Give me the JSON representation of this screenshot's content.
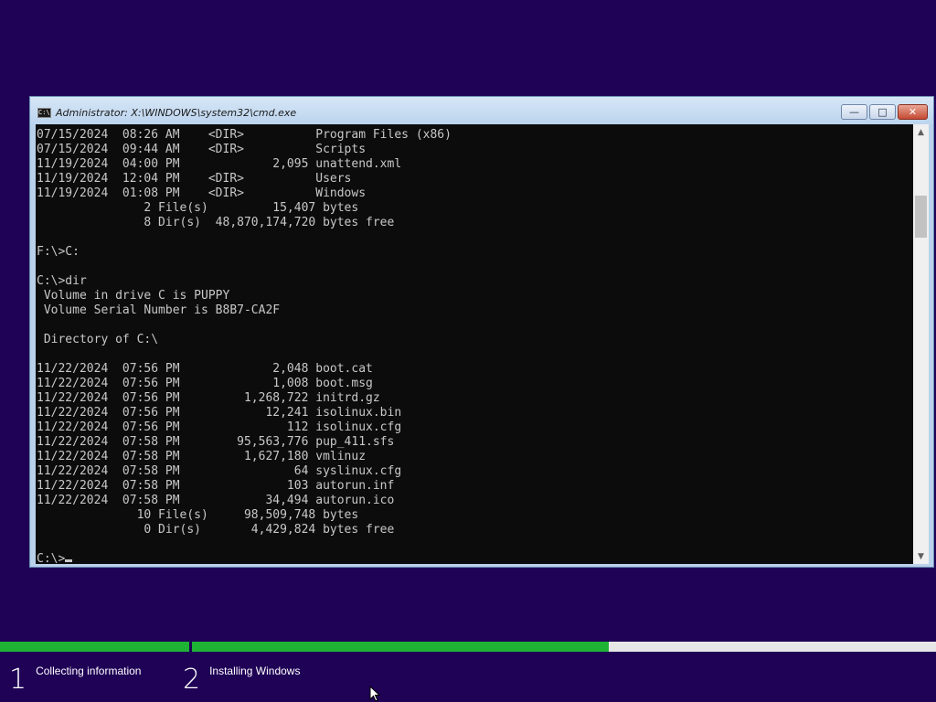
{
  "window": {
    "title": "Administrator: X:\\WINDOWS\\system32\\cmd.exe",
    "minimize_glyph": "—",
    "maximize_glyph": "□",
    "close_glyph": "✕"
  },
  "console": {
    "lines": [
      "07/15/2024  08:26 AM    <DIR>          Program Files (x86)",
      "07/15/2024  09:44 AM    <DIR>          Scripts",
      "11/19/2024  04:00 PM             2,095 unattend.xml",
      "11/19/2024  12:04 PM    <DIR>          Users",
      "11/19/2024  01:08 PM    <DIR>          Windows",
      "               2 File(s)         15,407 bytes",
      "               8 Dir(s)  48,870,174,720 bytes free",
      "",
      "F:\\>C:",
      "",
      "C:\\>dir",
      " Volume in drive C is PUPPY",
      " Volume Serial Number is B8B7-CA2F",
      "",
      " Directory of C:\\",
      "",
      "11/22/2024  07:56 PM             2,048 boot.cat",
      "11/22/2024  07:56 PM             1,008 boot.msg",
      "11/22/2024  07:56 PM         1,268,722 initrd.gz",
      "11/22/2024  07:56 PM            12,241 isolinux.bin",
      "11/22/2024  07:56 PM               112 isolinux.cfg",
      "11/22/2024  07:58 PM        95,563,776 pup_411.sfs",
      "11/22/2024  07:58 PM         1,627,180 vmlinuz",
      "11/22/2024  07:58 PM                64 syslinux.cfg",
      "11/22/2024  07:58 PM               103 autorun.inf",
      "11/22/2024  07:58 PM            34,494 autorun.ico",
      "              10 File(s)     98,509,748 bytes",
      "               0 Dir(s)       4,429,824 bytes free",
      ""
    ],
    "prompt": "C:\\>"
  },
  "setup": {
    "steps": [
      {
        "number": "1",
        "label": "Collecting information",
        "progress": 1.0
      },
      {
        "number": "2",
        "label": "Installing Windows",
        "progress": 0.56
      }
    ],
    "fill_color": "#1fb336",
    "track_color": "#e6e6e6"
  },
  "colors": {
    "background": "#1f0156",
    "console_bg": "#0c0c0c",
    "console_fg": "#c8c8c8"
  }
}
